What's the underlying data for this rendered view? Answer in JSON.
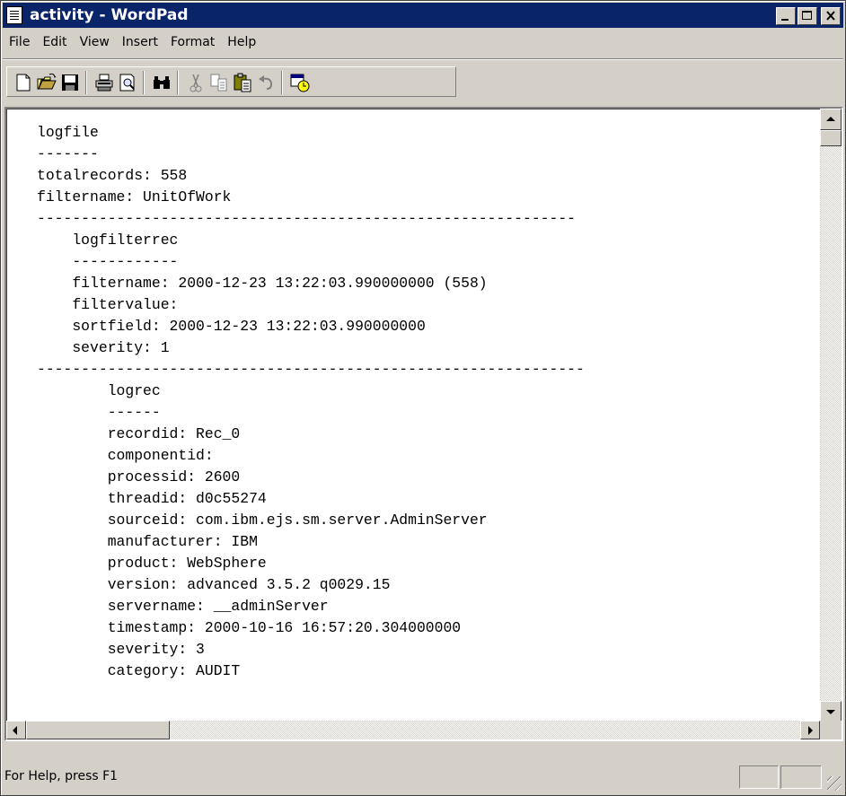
{
  "window": {
    "title": "activity - WordPad"
  },
  "menu": [
    "File",
    "Edit",
    "View",
    "Insert",
    "Format",
    "Help"
  ],
  "toolbar": {
    "icons": [
      "new-document-icon",
      "open-folder-icon",
      "save-disk-icon",
      "print-icon",
      "print-preview-icon",
      "find-binoculars-icon",
      "cut-scissors-icon",
      "copy-icon",
      "paste-icon",
      "undo-icon",
      "date-time-icon"
    ]
  },
  "document": {
    "lines": [
      "logfile",
      "-------",
      "totalrecords: 558",
      "filtername: UnitOfWork",
      "-------------------------------------------------------------",
      "    logfilterrec",
      "    ------------",
      "    filtername: 2000-12-23 13:22:03.990000000 (558)",
      "    filtervalue:",
      "    sortfield: 2000-12-23 13:22:03.990000000",
      "    severity: 1",
      "--------------------------------------------------------------",
      "        logrec",
      "        ------",
      "        recordid: Rec_0",
      "        componentid:",
      "        processid: 2600",
      "        threadid: d0c55274",
      "        sourceid: com.ibm.ejs.sm.server.AdminServer",
      "        manufacturer: IBM",
      "        product: WebSphere",
      "        version: advanced 3.5.2 q0029.15",
      "        servername: __adminServer",
      "        timestamp: 2000-10-16 16:57:20.304000000",
      "        severity: 3",
      "        category: AUDIT"
    ]
  },
  "statusbar": {
    "message": "For Help, press F1"
  }
}
